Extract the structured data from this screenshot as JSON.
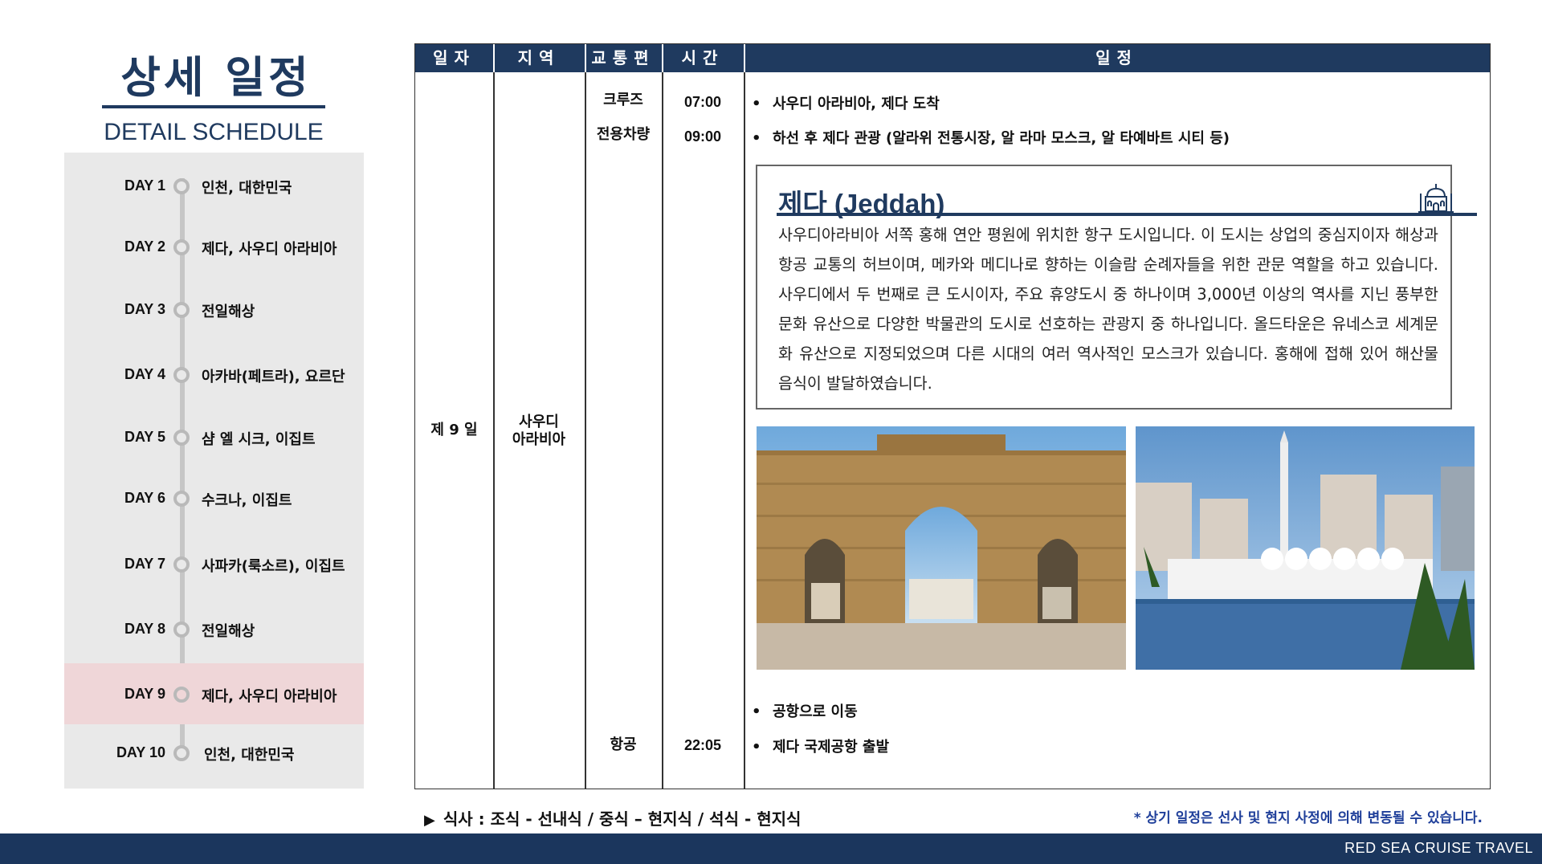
{
  "header": {
    "title_ko": "상세 일정",
    "title_en": "DETAIL SCHEDULE"
  },
  "days": [
    {
      "label": "DAY 1",
      "place": "인천, 대한민국"
    },
    {
      "label": "DAY 2",
      "place": "제다, 사우디 아라비아"
    },
    {
      "label": "DAY 3",
      "place": "전일해상"
    },
    {
      "label": "DAY 4",
      "place": "아카바(페트라), 요르단"
    },
    {
      "label": "DAY 5",
      "place": "샴 엘 시크, 이집트"
    },
    {
      "label": "DAY 6",
      "place": "수크나, 이집트"
    },
    {
      "label": "DAY 7",
      "place": "사파카(룩소르), 이집트"
    },
    {
      "label": "DAY 8",
      "place": "전일해상"
    },
    {
      "label": "DAY 9",
      "place": "제다, 사우디 아라비아"
    },
    {
      "label": "DAY 10",
      "place": "인천, 대한민국"
    }
  ],
  "active_day": "DAY 9",
  "table": {
    "headers": {
      "date": "일자",
      "region": "지역",
      "transport": "교통편",
      "time": "시간",
      "schedule": "일정"
    },
    "date_value": "제 9 일",
    "region_line1": "사우디",
    "region_line2": "아라비아",
    "rows": [
      {
        "transport": "크루즈",
        "time": "07:00",
        "text": "사우디 아라비아, 제다 도착"
      },
      {
        "transport": "전용차량",
        "time": "09:00",
        "text": "하선 후 제다 관광 (알라위 전통시장, 알 라마 모스크, 알 타예바트 시티 등)"
      },
      {
        "transport": "",
        "time": "",
        "text": "공항으로 이동"
      },
      {
        "transport": "항공",
        "time": "22:05",
        "text": "제다 국제공항 출발"
      }
    ]
  },
  "info": {
    "title": "제다 (Jeddah)",
    "icon": "mosque-icon",
    "body": "사우디아라비아 서쪽 홍해 연안 평원에 위치한 항구 도시입니다. 이 도시는 상업의 중심지이자 해상과 항공 교통의 허브이며, 메카와 메디나로 향하는 이슬람 순례자들을 위한 관문 역할을 하고 있습니다. 사우디에서 두 번째로 큰 도시이자, 주요 휴양도시 중 하나이며 3,000년 이상의 역사를 지닌 풍부한 문화 유산으로 다양한 박물관의 도시로 선호하는 관광지 중 하나입니다. 올드타운은 유네스코 세계문화 유산으로 지정되었으며 다른 시대의 여러 역사적인 모스크가 있습니다. 홍해에 접해 있어 해산물 음식이 발달하였습니다."
  },
  "notes": {
    "meal": "식사 : 조식 - 선내식 / 중식 – 현지식 / 석식 - 현지식",
    "notice": "* 상기 일정은 선사 및 현지 사정에 의해 변동될 수 있습니다."
  },
  "footer": {
    "brand": "RED SEA CRUISE TRAVEL"
  },
  "colors": {
    "navy": "#1f3a5f",
    "footer": "#1b365d",
    "active_row": "#efd6d8",
    "panel": "#e9e9e9",
    "notice": "#1f3f9a"
  }
}
